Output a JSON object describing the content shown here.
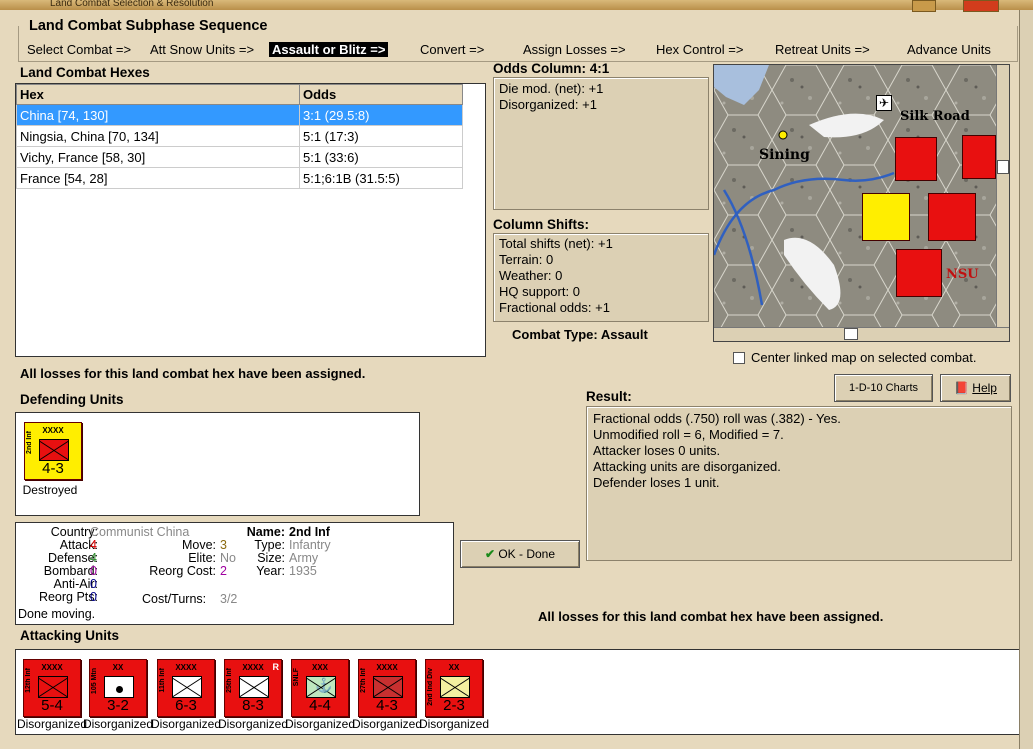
{
  "window": {
    "title": "Land Combat Selection & Resolution"
  },
  "sequence": {
    "label": "Land Combat Subphase Sequence",
    "steps": [
      "Select Combat =>",
      "Att Snow Units =>",
      "Assault or Blitz =>",
      "Convert =>",
      "Assign Losses =>",
      "Hex Control =>",
      "Retreat Units =>",
      "Advance Units"
    ],
    "active_index": 2
  },
  "hexes": {
    "label": "Land Combat Hexes",
    "columns": [
      "Hex",
      "Odds"
    ],
    "rows": [
      {
        "hex": "China [74, 130]",
        "odds": "3:1 (29.5:8)",
        "selected": true
      },
      {
        "hex": "Ningsia, China [70, 134]",
        "odds": "5:1 (17:3)"
      },
      {
        "hex": "Vichy, France [58, 30]",
        "odds": "5:1 (33:6)"
      },
      {
        "hex": "France [54, 28]",
        "odds": "5:1;6:1B (31.5:5)"
      }
    ]
  },
  "odds_column": {
    "label": "Odds Column: 4:1",
    "lines": [
      "Die mod. (net): +1",
      "Disorganized: +1"
    ]
  },
  "column_shifts": {
    "label": "Column Shifts:",
    "lines": [
      "Total shifts (net): +1",
      "Terrain: 0",
      "Weather: 0",
      "HQ support: 0",
      "Fractional odds: +1"
    ]
  },
  "combat_type": "Combat Type:  Assault",
  "map": {
    "labels": {
      "silk_road": "Silk Road",
      "sining": "Sining",
      "nsu": "NSU"
    },
    "center_linked_label": "Center linked map on selected combat."
  },
  "losses_msg_top": "All losses for this land combat hex have been assigned.",
  "losses_msg_bottom": "All losses for this land combat hex have been assigned.",
  "buttons": {
    "charts": "1-D-10 Charts",
    "help": "Help",
    "ok": "OK - Done"
  },
  "result": {
    "label": "Result:",
    "lines": [
      "Fractional odds (.750) roll was (.382)  - Yes.",
      "Unmodified roll = 6, Modified = 7.",
      "Attacker loses 0 units.",
      "Attacking units are disorganized.",
      "Defender loses 1 unit."
    ]
  },
  "defending": {
    "label": "Defending Units",
    "units": [
      {
        "name": "2nd Inf",
        "size": "XXXX",
        "strength": "4-3",
        "status": "Destroyed",
        "color": "#ffee00"
      }
    ]
  },
  "details": {
    "country_label": "Country:",
    "country": "Communist China",
    "attack_label": "Attack:",
    "attack": "4",
    "defense_label": "Defense:",
    "defense": "4",
    "bombard_label": "Bombard:",
    "bombard": "0",
    "antiair_label": "Anti-Air:",
    "antiair": "0",
    "reorg_pts_label": "Reorg Pts:",
    "reorg_pts": "0",
    "done_moving": "Done moving.",
    "move_label": "Move:",
    "move": "3",
    "elite_label": "Elite:",
    "elite": "No",
    "reorg_cost_label": "Reorg Cost:",
    "reorg_cost": "2",
    "cost_turns_label": "Cost/Turns:",
    "cost_turns": "3/2",
    "name_label": "Name:",
    "name": "2nd Inf",
    "type_label": "Type:",
    "type": "Infantry",
    "size_label": "Size:",
    "size": "Army",
    "year_label": "Year:",
    "year": "1935"
  },
  "attacking": {
    "label": "Attacking Units",
    "units": [
      {
        "name": "12th Inf",
        "size": "XXXX",
        "strength": "5-4",
        "status": "Disorganized"
      },
      {
        "name": "105 Mtn",
        "size": "XX",
        "strength": "3-2",
        "status": "Disorganized"
      },
      {
        "name": "11th Inf",
        "size": "XXXX",
        "strength": "6-3",
        "status": "Disorganized"
      },
      {
        "name": "25th Inf",
        "size": "XXXX",
        "strength": "8-3",
        "status": "Disorganized"
      },
      {
        "name": "SNLF",
        "size": "XXX",
        "strength": "4-4",
        "status": "Disorganized"
      },
      {
        "name": "27th Inf",
        "size": "XXXX",
        "strength": "4-3",
        "status": "Disorganized"
      },
      {
        "name": "2nd Ind Div",
        "size": "XX",
        "strength": "2-3",
        "status": "Disorganized"
      }
    ]
  },
  "colors": {
    "japan_red": "#e81010",
    "china_yellow": "#ffee00",
    "selection_blue": "#3399ff"
  }
}
